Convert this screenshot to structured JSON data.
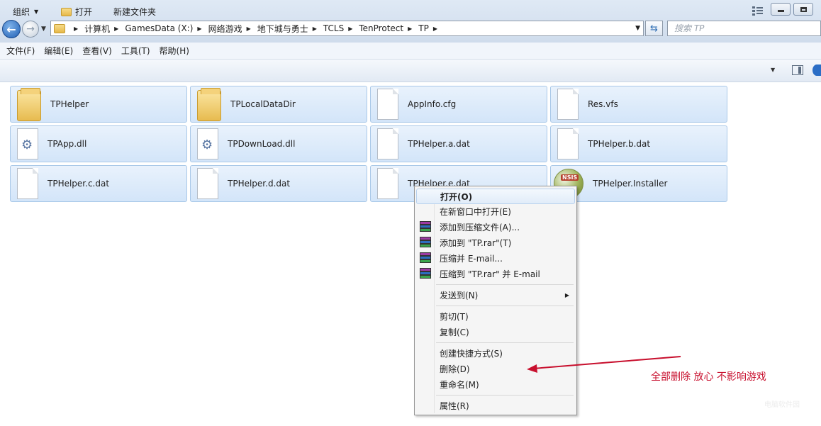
{
  "nav": {
    "back_glyph": "←",
    "fwd_glyph": "→",
    "breadcrumb": [
      "计算机",
      "GamesData (X:)",
      "网络游戏",
      "地下城与勇士",
      "TCLS",
      "TenProtect",
      "TP"
    ],
    "search_placeholder": "搜索 TP",
    "refresh_glyph": "⇆"
  },
  "menubar": [
    "文件(F)",
    "编辑(E)",
    "查看(V)",
    "工具(T)",
    "帮助(H)"
  ],
  "toolbar": {
    "organize": "组织",
    "open": "打开",
    "new_folder": "新建文件夹"
  },
  "files": [
    {
      "name": "TPHelper",
      "icon": "folder-icon"
    },
    {
      "name": "TPLocalDataDir",
      "icon": "folder-icon"
    },
    {
      "name": "AppInfo.cfg",
      "icon": "document-icon"
    },
    {
      "name": "Res.vfs",
      "icon": "document-icon"
    },
    {
      "name": "TPApp.dll",
      "icon": "dll-icon"
    },
    {
      "name": "TPDownLoad.dll",
      "icon": "dll-icon"
    },
    {
      "name": "TPHelper.a.dat",
      "icon": "document-icon"
    },
    {
      "name": "TPHelper.b.dat",
      "icon": "document-icon"
    },
    {
      "name": "TPHelper.c.dat",
      "icon": "document-icon"
    },
    {
      "name": "TPHelper.d.dat",
      "icon": "document-icon"
    },
    {
      "name": "TPHelper.e.dat",
      "icon": "document-icon"
    },
    {
      "name": "TPHelper.Installer",
      "icon": "nsis-installer-icon"
    }
  ],
  "context_menu": {
    "open": "打开(O)",
    "open_new_window": "在新窗口中打开(E)",
    "add_to_archive": "添加到压缩文件(A)...",
    "add_to_tp_rar": "添加到 \"TP.rar\"(T)",
    "compress_email": "压缩并 E-mail...",
    "compress_tp_email": "压缩到 \"TP.rar\" 并 E-mail",
    "send_to": "发送到(N)",
    "cut": "剪切(T)",
    "copy": "复制(C)",
    "create_shortcut": "创建快捷方式(S)",
    "delete": "删除(D)",
    "rename": "重命名(M)",
    "properties": "属性(R)"
  },
  "annotation": {
    "note": "全部删除 放心 不影响游戏",
    "color": "#c8102e"
  },
  "watermark": "电脑软件园"
}
